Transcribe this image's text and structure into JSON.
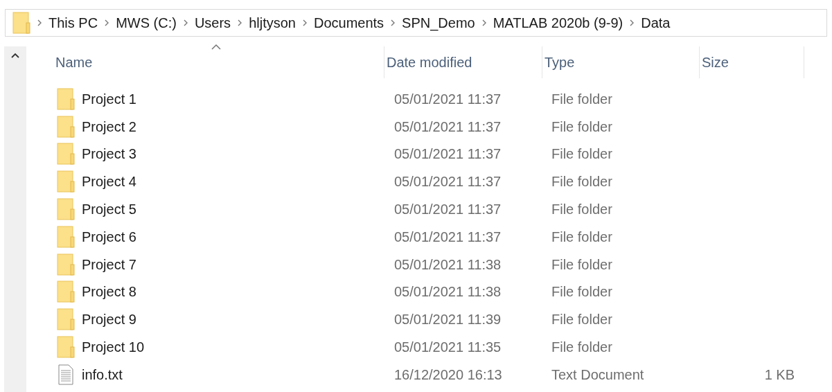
{
  "breadcrumb": [
    "This PC",
    "MWS (C:)",
    "Users",
    "hljtyson",
    "Documents",
    "SPN_Demo",
    "MATLAB 2020b (9-9)",
    "Data"
  ],
  "columns": [
    {
      "label": "Name",
      "sorted": true
    },
    {
      "label": "Date modified",
      "sorted": false
    },
    {
      "label": "Type",
      "sorted": false
    },
    {
      "label": "Size",
      "sorted": false
    }
  ],
  "rows": [
    {
      "kind": "folder",
      "name": "Project 1",
      "date": "05/01/2021 11:37",
      "type": "File folder"
    },
    {
      "kind": "folder",
      "name": "Project 2",
      "date": "05/01/2021 11:37",
      "type": "File folder"
    },
    {
      "kind": "folder",
      "name": "Project 3",
      "date": "05/01/2021 11:37",
      "type": "File folder"
    },
    {
      "kind": "folder",
      "name": "Project 4",
      "date": "05/01/2021 11:37",
      "type": "File folder"
    },
    {
      "kind": "folder",
      "name": "Project 5",
      "date": "05/01/2021 11:37",
      "type": "File folder"
    },
    {
      "kind": "folder",
      "name": "Project 6",
      "date": "05/01/2021 11:37",
      "type": "File folder"
    },
    {
      "kind": "folder",
      "name": "Project 7",
      "date": "05/01/2021 11:38",
      "type": "File folder"
    },
    {
      "kind": "folder",
      "name": "Project 8",
      "date": "05/01/2021 11:38",
      "type": "File folder"
    },
    {
      "kind": "folder",
      "name": "Project 9",
      "date": "05/01/2021 11:39",
      "type": "File folder"
    },
    {
      "kind": "folder",
      "name": "Project 10",
      "date": "05/01/2021 11:35",
      "type": "File folder"
    },
    {
      "kind": "text",
      "name": "info.txt",
      "date": "16/12/2020 16:13",
      "type": "Text Document",
      "size": "1 KB"
    }
  ]
}
